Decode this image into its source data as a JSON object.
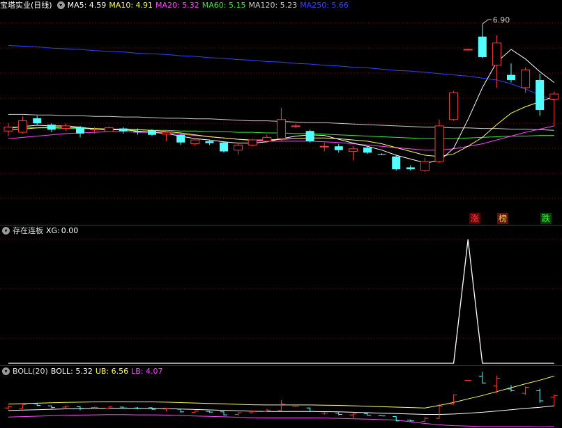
{
  "main": {
    "title": "宝塔实业(日线)",
    "ma": [
      {
        "label": "MA5:",
        "value": "4.59",
        "color": "#ffffff"
      },
      {
        "label": "MA10:",
        "value": "4.91",
        "color": "#ffff55"
      },
      {
        "label": "MA20:",
        "value": "5.32",
        "color": "#ff44ff"
      },
      {
        "label": "MA60:",
        "value": "5.15",
        "color": "#33ee33"
      },
      {
        "label": "MA120:",
        "value": "5.23",
        "color": "#cccccc"
      },
      {
        "label": "MA250:",
        "value": "5.66",
        "color": "#3344ff"
      }
    ],
    "peak_label": "6.90",
    "tags": [
      {
        "text": "涨",
        "color": "#ff4444",
        "bg": "#5a0000"
      },
      {
        "text": "榜",
        "color": "#ffcc44",
        "bg": "#5a1800"
      },
      {
        "text": "跌",
        "color": "#44ff44",
        "bg": "#004400"
      }
    ]
  },
  "xg": {
    "title": "存在连板",
    "label": "XG:",
    "value": "0.00"
  },
  "boll": {
    "title": "BOLL(20)",
    "items": [
      {
        "label": "BOLL:",
        "value": "5.32",
        "color": "#ffffff"
      },
      {
        "label": "UB:",
        "value": "6.56",
        "color": "#ffff55"
      },
      {
        "label": "LB:",
        "value": "4.07",
        "color": "#ff44ff"
      }
    ]
  },
  "chart_data": {
    "type": "candlestick",
    "y_top": 7.1,
    "y_bottom": 4.0,
    "candles": [
      {
        "o": 5.22,
        "h": 5.34,
        "l": 5.14,
        "c": 5.28
      },
      {
        "o": 5.2,
        "h": 5.45,
        "l": 5.18,
        "c": 5.38
      },
      {
        "o": 5.42,
        "h": 5.46,
        "l": 5.32,
        "c": 5.34
      },
      {
        "o": 5.32,
        "h": 5.34,
        "l": 5.2,
        "c": 5.24
      },
      {
        "o": 5.26,
        "h": 5.34,
        "l": 5.22,
        "c": 5.3
      },
      {
        "o": 5.28,
        "h": 5.3,
        "l": 5.12,
        "c": 5.18
      },
      {
        "o": 5.24,
        "h": 5.28,
        "l": 5.18,
        "c": 5.25
      },
      {
        "o": 5.21,
        "h": 5.29,
        "l": 5.2,
        "c": 5.27
      },
      {
        "o": 5.26,
        "h": 5.28,
        "l": 5.18,
        "c": 5.22
      },
      {
        "o": 5.22,
        "h": 5.26,
        "l": 5.16,
        "c": 5.2
      },
      {
        "o": 5.23,
        "h": 5.25,
        "l": 5.14,
        "c": 5.16
      },
      {
        "o": 5.17,
        "h": 5.22,
        "l": 5.06,
        "c": 5.2
      },
      {
        "o": 5.16,
        "h": 5.18,
        "l": 5.0,
        "c": 5.04
      },
      {
        "o": 5.02,
        "h": 5.11,
        "l": 4.98,
        "c": 5.08
      },
      {
        "o": 5.06,
        "h": 5.08,
        "l": 5.0,
        "c": 5.03
      },
      {
        "o": 5.04,
        "h": 5.06,
        "l": 4.88,
        "c": 4.9
      },
      {
        "o": 4.92,
        "h": 5.02,
        "l": 4.85,
        "c": 5.0
      },
      {
        "o": 5.0,
        "h": 5.1,
        "l": 4.98,
        "c": 5.08
      },
      {
        "o": 5.06,
        "h": 5.16,
        "l": 5.04,
        "c": 5.12
      },
      {
        "o": 5.1,
        "h": 5.58,
        "l": 5.06,
        "c": 5.4
      },
      {
        "o": 5.3,
        "h": 5.33,
        "l": 5.27,
        "c": 5.3
      },
      {
        "o": 5.22,
        "h": 5.24,
        "l": 5.04,
        "c": 5.06
      },
      {
        "o": 4.98,
        "h": 5.04,
        "l": 4.9,
        "c": 4.98
      },
      {
        "o": 4.98,
        "h": 5.02,
        "l": 4.88,
        "c": 4.92
      },
      {
        "o": 4.9,
        "h": 4.98,
        "l": 4.76,
        "c": 4.94
      },
      {
        "o": 4.96,
        "h": 4.98,
        "l": 4.86,
        "c": 4.88
      },
      {
        "o": 4.86,
        "h": 4.87,
        "l": 4.84,
        "c": 4.85
      },
      {
        "o": 4.82,
        "h": 4.84,
        "l": 4.6,
        "c": 4.62
      },
      {
        "o": 4.65,
        "h": 4.68,
        "l": 4.6,
        "c": 4.62
      },
      {
        "o": 4.6,
        "h": 4.8,
        "l": 4.58,
        "c": 4.74
      },
      {
        "o": 4.74,
        "h": 5.4,
        "l": 4.72,
        "c": 5.3
      },
      {
        "o": 5.4,
        "h": 5.85,
        "l": 5.38,
        "c": 5.82
      },
      {
        "o": 6.5,
        "h": 6.51,
        "l": 6.49,
        "c": 6.5
      },
      {
        "o": 6.7,
        "h": 6.9,
        "l": 6.36,
        "c": 6.38
      },
      {
        "o": 6.25,
        "h": 6.72,
        "l": 5.9,
        "c": 6.6
      },
      {
        "o": 6.1,
        "h": 6.28,
        "l": 5.98,
        "c": 6.02
      },
      {
        "o": 5.9,
        "h": 6.22,
        "l": 5.82,
        "c": 6.18
      },
      {
        "o": 6.02,
        "h": 6.12,
        "l": 5.46,
        "c": 5.55
      },
      {
        "o": 5.72,
        "h": 5.84,
        "l": 5.3,
        "c": 5.8
      }
    ],
    "ma5": [
      5.26,
      5.29,
      5.31,
      5.3,
      5.3,
      5.28,
      5.25,
      5.24,
      5.24,
      5.22,
      5.2,
      5.18,
      5.14,
      5.1,
      5.08,
      5.05,
      5.03,
      5.03,
      5.05,
      5.1,
      5.14,
      5.16,
      5.15,
      5.09,
      5.03,
      4.98,
      4.92,
      4.84,
      4.78,
      4.72,
      4.75,
      4.95,
      5.4,
      5.9,
      6.3,
      6.5,
      6.35,
      6.15,
      5.98
    ],
    "ma10": [
      5.24,
      5.25,
      5.27,
      5.28,
      5.28,
      5.27,
      5.26,
      5.25,
      5.25,
      5.24,
      5.23,
      5.21,
      5.19,
      5.16,
      5.13,
      5.11,
      5.09,
      5.08,
      5.08,
      5.09,
      5.1,
      5.11,
      5.11,
      5.1,
      5.08,
      5.06,
      5.02,
      4.96,
      4.9,
      4.84,
      4.82,
      4.86,
      4.98,
      5.12,
      5.32,
      5.5,
      5.6,
      5.68,
      5.76
    ],
    "ma20": [
      5.1,
      5.12,
      5.14,
      5.16,
      5.18,
      5.19,
      5.2,
      5.21,
      5.21,
      5.2,
      5.2,
      5.19,
      5.17,
      5.15,
      5.13,
      5.11,
      5.09,
      5.07,
      5.06,
      5.06,
      5.06,
      5.06,
      5.05,
      5.04,
      5.02,
      5.0,
      4.98,
      4.96,
      4.94,
      4.92,
      4.92,
      4.94,
      4.98,
      5.02,
      5.08,
      5.14,
      5.2,
      5.25,
      5.3
    ],
    "ma60": [
      5.28,
      5.28,
      5.27,
      5.27,
      5.26,
      5.26,
      5.25,
      5.25,
      5.24,
      5.24,
      5.23,
      5.23,
      5.22,
      5.22,
      5.21,
      5.21,
      5.2,
      5.2,
      5.19,
      5.19,
      5.18,
      5.18,
      5.17,
      5.16,
      5.15,
      5.14,
      5.13,
      5.12,
      5.11,
      5.1,
      5.1,
      5.1,
      5.11,
      5.12,
      5.13,
      5.14,
      5.14,
      5.15,
      5.15
    ],
    "ma120": [
      5.48,
      5.48,
      5.47,
      5.47,
      5.46,
      5.46,
      5.45,
      5.45,
      5.44,
      5.44,
      5.43,
      5.42,
      5.42,
      5.41,
      5.41,
      5.4,
      5.39,
      5.38,
      5.38,
      5.37,
      5.36,
      5.35,
      5.35,
      5.34,
      5.33,
      5.32,
      5.31,
      5.3,
      5.29,
      5.28,
      5.28,
      5.27,
      5.27,
      5.26,
      5.26,
      5.25,
      5.25,
      5.24,
      5.23
    ],
    "ma250": [
      6.56,
      6.55,
      6.54,
      6.52,
      6.51,
      6.5,
      6.48,
      6.47,
      6.46,
      6.44,
      6.43,
      6.42,
      6.4,
      6.39,
      6.37,
      6.36,
      6.34,
      6.33,
      6.31,
      6.3,
      6.28,
      6.27,
      6.25,
      6.24,
      6.22,
      6.21,
      6.19,
      6.17,
      6.16,
      6.14,
      6.12,
      6.1,
      6.08,
      6.05,
      6.02,
      5.96,
      5.88,
      5.78,
      5.7
    ],
    "xg_series": {
      "values": [
        0,
        0,
        0,
        0,
        0,
        0,
        0,
        0,
        0,
        0,
        0,
        0,
        0,
        0,
        0,
        0,
        0,
        0,
        0,
        0,
        0,
        0,
        0,
        0,
        0,
        0,
        0,
        0,
        0,
        0,
        0,
        0,
        1,
        0,
        0,
        0,
        0,
        0,
        0
      ],
      "ylim": [
        0,
        1
      ]
    },
    "boll_series": {
      "ylim": [
        4.0,
        7.1
      ],
      "boll_line": [
        5.1,
        5.12,
        5.14,
        5.16,
        5.18,
        5.19,
        5.2,
        5.21,
        5.21,
        5.2,
        5.2,
        5.19,
        5.17,
        5.15,
        5.13,
        5.11,
        5.09,
        5.07,
        5.06,
        5.06,
        5.06,
        5.06,
        5.05,
        5.04,
        5.02,
        5.0,
        4.98,
        4.96,
        4.94,
        4.92,
        4.92,
        4.94,
        4.98,
        5.02,
        5.08,
        5.14,
        5.2,
        5.25,
        5.32
      ]
    }
  }
}
